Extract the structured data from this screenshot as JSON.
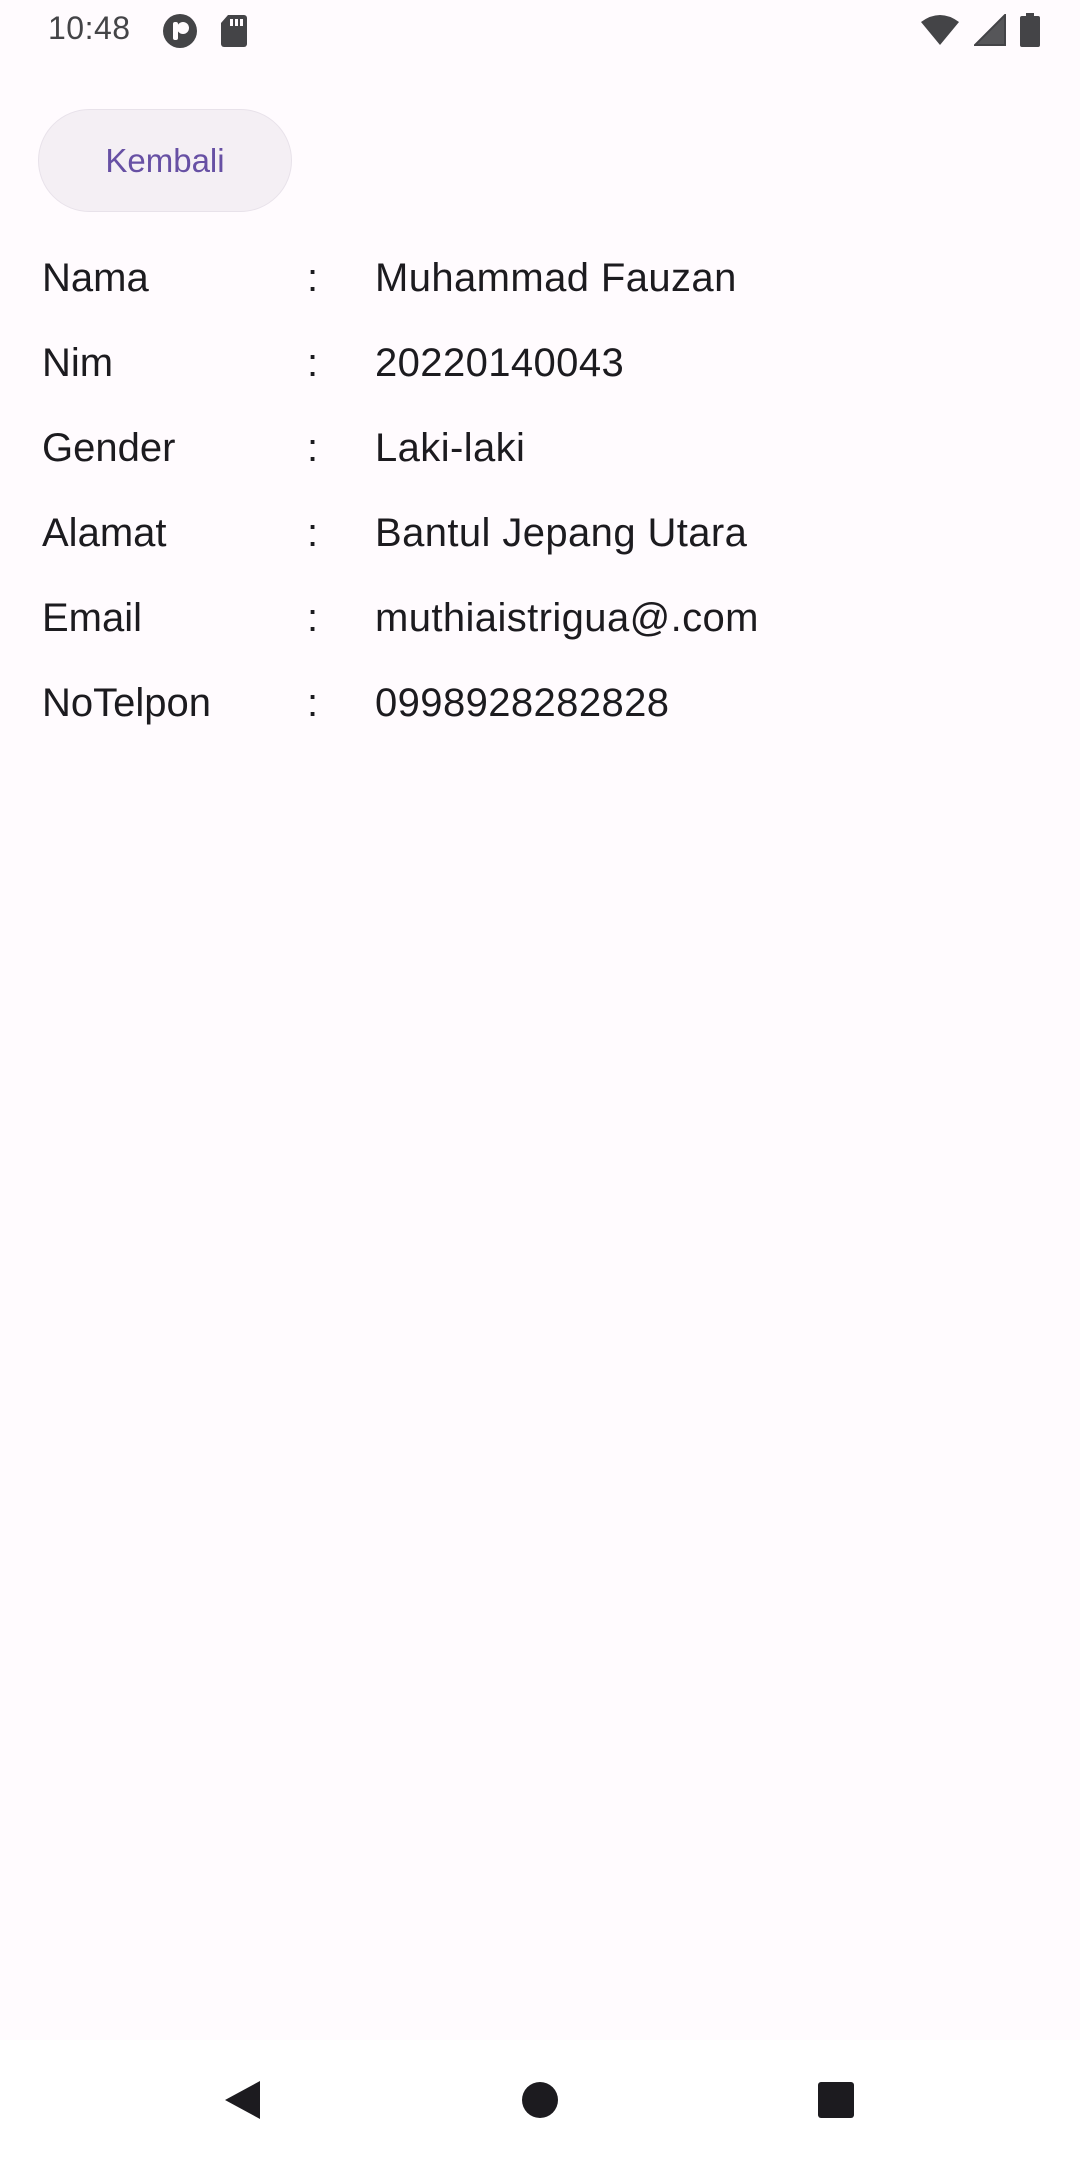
{
  "status_bar": {
    "time": "10:48",
    "left_icons": [
      "app-notification-icon",
      "sd-card-icon"
    ],
    "right_icons": [
      "wifi-icon",
      "cell-signal-icon",
      "battery-icon"
    ]
  },
  "back_button": {
    "label": "Kembali"
  },
  "details": [
    {
      "label": "Nama",
      "separator": ":",
      "value": "Muhammad Fauzan"
    },
    {
      "label": "Nim",
      "separator": ":",
      "value": "20220140043"
    },
    {
      "label": "Gender",
      "separator": ":",
      "value": "Laki-laki"
    },
    {
      "label": "Alamat",
      "separator": ":",
      "value": "Bantul Jepang Utara"
    },
    {
      "label": "Email",
      "separator": ":",
      "value": "muthiaistrigua@.com"
    },
    {
      "label": "NoTelpon",
      "separator": ":",
      "value": "0998928282828"
    }
  ],
  "nav_bar": {
    "buttons": [
      "back-triangle-icon",
      "home-circle-icon",
      "recents-square-icon"
    ]
  },
  "colors": {
    "background": "#fffbfe",
    "accent": "#6750a4",
    "button_bg": "#f4eff4"
  }
}
